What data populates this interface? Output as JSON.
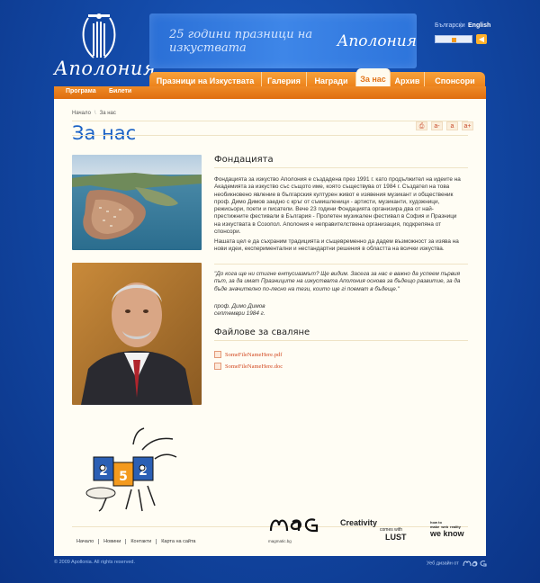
{
  "header": {
    "logo_text": "Аполония",
    "banner_text": "25 години празници на изкуствата",
    "banner_logo": "Аполония",
    "lang_bg": "Български",
    "lang_sep": "|",
    "lang_en": "English"
  },
  "nav": {
    "tabs": [
      "Празници на Изкуствата",
      "Галерия",
      "Награди",
      "За нас",
      "Архив",
      "Спонсори"
    ],
    "active": "За нас",
    "sub": [
      "Програма",
      "Билети"
    ]
  },
  "breadcrumb": {
    "home": "Начало",
    "sep": "\\",
    "current": "За нас"
  },
  "page": {
    "title": "За нас",
    "tools": [
      "print-icon",
      "a-",
      "a",
      "a+"
    ],
    "tool_labels": [
      "⎙",
      "a-",
      "a",
      "a+"
    ],
    "section1_heading": "Фондацията",
    "para1": "Фондацията за изкуство Аполония е създадена през 1991 г. като продължител на идеите на Академията за изкуство със същото име, която съществува от 1984 г. Създател на това необикновено явление в българския културен живот е изявения музикант и общественик проф. Димо Димов заедно с кръг от съмишленици - артисти, музиканти, художници, режисьори, поети и писатели. Вече 23 години Фондацията организира два от най-престижните фестивали в България - Пролетен музикален фестивал в София и Празници на изкуствата в Созопол. Аполония е неправителствена организация, подкрепяна от спонсори.",
    "para2": "Нашата цел е да съхраним традицията и същевременно да дадем възможност за изява на нови идеи, експериментални и нестандартни решения в областта на всички изкуства.",
    "quote": "\"До кога ще ни стигне ентусиазмът? Ще видим. Засега за нас е важно да успеем първия път, за да имат Празниците на изкуствата Аполония основа за бъдещо развитие, за да бъде значително по-лесно на тези, които ще гi поемат в бъдеще.\"",
    "signature": "проф. Димо Димов",
    "sig_date": "септември 1984 г.",
    "files_heading": "Файлове за сваляне",
    "files": [
      "SomeFileNameHere.pdf",
      "SomeFileNameHere.doc"
    ]
  },
  "footer": {
    "links": [
      "Начало",
      "Новини",
      "Контакти",
      "Карта на сайта"
    ],
    "sponsors": {
      "mag_text": "magmatic.bg",
      "creativity_line1": "Creativity",
      "creativity_line2": "comes with",
      "creativity_line3": "LUST",
      "we_know_line1": "how to",
      "we_know_line2": "make",
      "we_know_line3": "web",
      "we_know_line4": "reality",
      "we_know_line5": "we know"
    },
    "copyright": "© 2009 Apollonia. All rights reserved.",
    "webdesign": "Уеб дизайн от"
  }
}
